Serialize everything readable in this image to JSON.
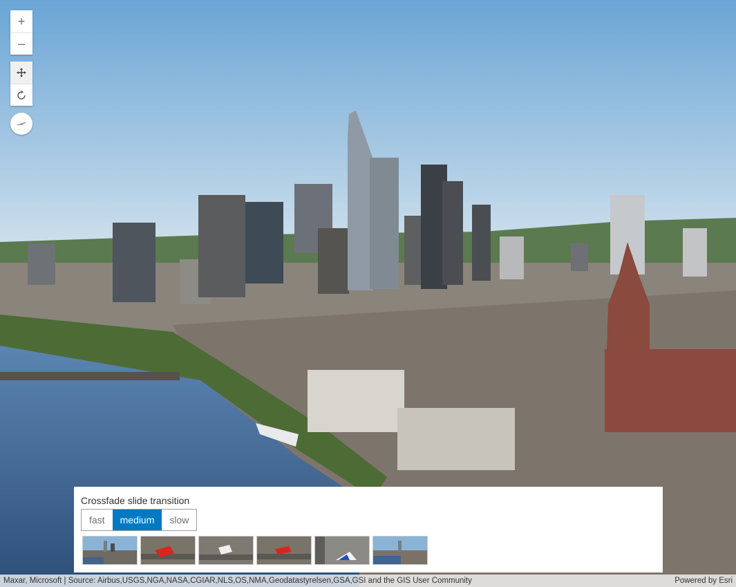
{
  "navigation": {
    "zoom_in_label": "+",
    "zoom_out_label": "–",
    "pan_icon": "pan-icon",
    "rotate_icon": "rotate-icon",
    "compass_icon": "compass-icon"
  },
  "slides_panel": {
    "title": "Crossfade slide transition",
    "transition_options": [
      "fast",
      "medium",
      "slow"
    ],
    "selected_option": "medium",
    "slides": [
      {
        "theme": "skyline"
      },
      {
        "theme": "river-red"
      },
      {
        "theme": "aerial-white"
      },
      {
        "theme": "aerial-red"
      },
      {
        "theme": "street-blue"
      },
      {
        "theme": "skyline-river"
      }
    ]
  },
  "attribution": {
    "sources": "Maxar, Microsoft | Source: Airbus,USGS,NGA,NASA,CGIAR,NLS,OS,NMA,Geodatastyrelsen,GSA,GSI and the GIS User Community",
    "powered_by": "Powered by Esri"
  },
  "colors": {
    "accent": "#0079c1",
    "sky_top": "#6fa8d6",
    "sky_bottom": "#c9dcea",
    "river": "#3d6a99"
  }
}
